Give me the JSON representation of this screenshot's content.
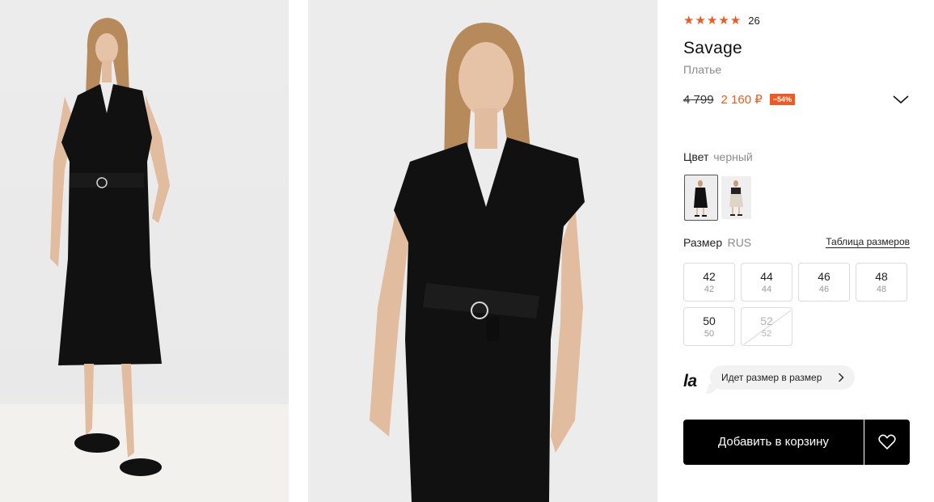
{
  "product": {
    "rating_count": "26",
    "stars": 5,
    "brand": "Savage",
    "category": "Платье",
    "old_price": "4 799",
    "new_price": "2 160 ₽",
    "discount": "−54%"
  },
  "color": {
    "label": "Цвет",
    "value": "черный",
    "swatches": [
      "black",
      "beige"
    ]
  },
  "size": {
    "label": "Размер",
    "system": "RUS",
    "table_link": "Таблица размеров",
    "options": [
      {
        "main": "42",
        "sub": "42",
        "available": true
      },
      {
        "main": "44",
        "sub": "44",
        "available": true
      },
      {
        "main": "46",
        "sub": "46",
        "available": true
      },
      {
        "main": "48",
        "sub": "48",
        "available": true
      },
      {
        "main": "50",
        "sub": "50",
        "available": true
      },
      {
        "main": "52",
        "sub": "52",
        "available": false
      }
    ]
  },
  "fit": {
    "logo": "la",
    "text": "Идет размер в размер"
  },
  "actions": {
    "add_to_cart": "Добавить в корзину",
    "favorite_icon": "heart-icon"
  },
  "colors": {
    "accent": "#f05a22",
    "button": "#000000"
  }
}
